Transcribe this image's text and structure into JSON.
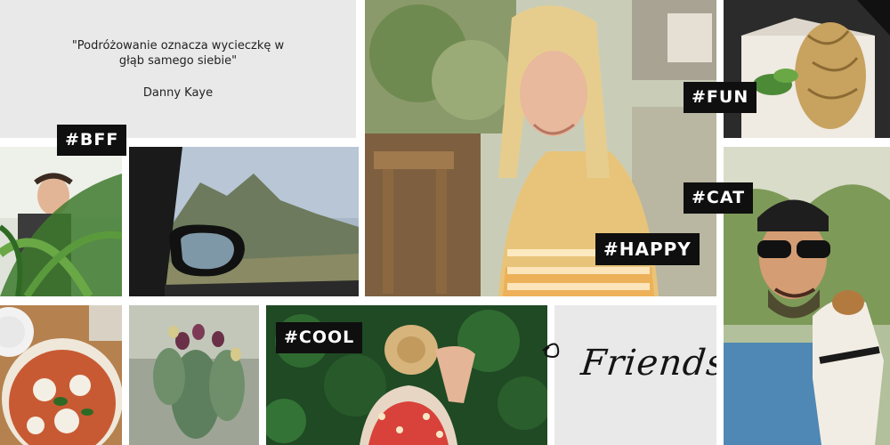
{
  "quote": {
    "text": "\"Podróżowanie oznacza wycieczkę w głąb samego siebie\"",
    "author": "Danny Kaye"
  },
  "tags": {
    "bff": "#BFF",
    "fun": "#FUN",
    "cat": "#CAT",
    "happy": "#HAPPY",
    "cool": "#COOL"
  },
  "friends_label": "Friends"
}
